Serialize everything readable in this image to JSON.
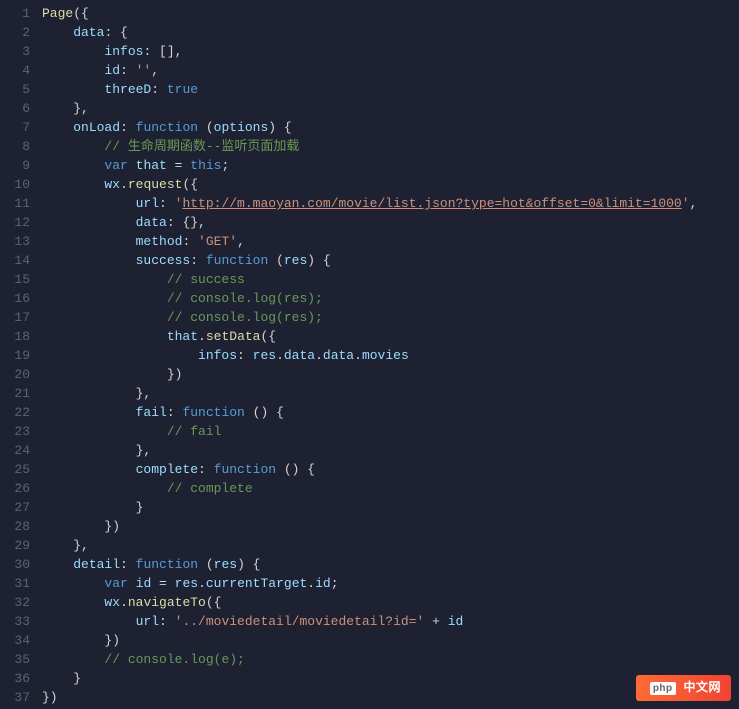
{
  "watermark": {
    "text": "中文网"
  },
  "lines": [
    {
      "n": 1,
      "tokens": [
        {
          "c": "tok-fn",
          "t": "Page"
        },
        {
          "c": "tok-punc",
          "t": "({"
        }
      ]
    },
    {
      "n": 2,
      "tokens": [
        {
          "c": "tok-punc",
          "t": "    "
        },
        {
          "c": "tok-prop",
          "t": "data"
        },
        {
          "c": "tok-punc",
          "t": ": {"
        }
      ]
    },
    {
      "n": 3,
      "tokens": [
        {
          "c": "tok-punc",
          "t": "        "
        },
        {
          "c": "tok-prop",
          "t": "infos"
        },
        {
          "c": "tok-punc",
          "t": ": [],"
        }
      ]
    },
    {
      "n": 4,
      "tokens": [
        {
          "c": "tok-punc",
          "t": "        "
        },
        {
          "c": "tok-prop",
          "t": "id"
        },
        {
          "c": "tok-punc",
          "t": ": "
        },
        {
          "c": "tok-str",
          "t": "''"
        },
        {
          "c": "tok-punc",
          "t": ","
        }
      ]
    },
    {
      "n": 5,
      "tokens": [
        {
          "c": "tok-punc",
          "t": "        "
        },
        {
          "c": "tok-prop",
          "t": "threeD"
        },
        {
          "c": "tok-punc",
          "t": ": "
        },
        {
          "c": "tok-bool",
          "t": "true"
        }
      ]
    },
    {
      "n": 6,
      "tokens": [
        {
          "c": "tok-punc",
          "t": "    },"
        }
      ]
    },
    {
      "n": 7,
      "tokens": [
        {
          "c": "tok-punc",
          "t": "    "
        },
        {
          "c": "tok-prop",
          "t": "onLoad"
        },
        {
          "c": "tok-punc",
          "t": ": "
        },
        {
          "c": "tok-kw",
          "t": "function"
        },
        {
          "c": "tok-punc",
          "t": " ("
        },
        {
          "c": "tok-var",
          "t": "options"
        },
        {
          "c": "tok-punc",
          "t": ") {"
        }
      ]
    },
    {
      "n": 8,
      "tokens": [
        {
          "c": "tok-punc",
          "t": "        "
        },
        {
          "c": "tok-comment",
          "t": "// 生命周期函数--监听页面加载"
        }
      ]
    },
    {
      "n": 9,
      "tokens": [
        {
          "c": "tok-punc",
          "t": "        "
        },
        {
          "c": "tok-kw",
          "t": "var"
        },
        {
          "c": "tok-punc",
          "t": " "
        },
        {
          "c": "tok-var",
          "t": "that"
        },
        {
          "c": "tok-punc",
          "t": " = "
        },
        {
          "c": "tok-this",
          "t": "this"
        },
        {
          "c": "tok-punc",
          "t": ";"
        }
      ]
    },
    {
      "n": 10,
      "tokens": [
        {
          "c": "tok-punc",
          "t": "        "
        },
        {
          "c": "tok-var",
          "t": "wx"
        },
        {
          "c": "tok-punc",
          "t": "."
        },
        {
          "c": "tok-fn",
          "t": "request"
        },
        {
          "c": "tok-punc",
          "t": "({"
        }
      ]
    },
    {
      "n": 11,
      "tokens": [
        {
          "c": "tok-punc",
          "t": "            "
        },
        {
          "c": "tok-prop",
          "t": "url"
        },
        {
          "c": "tok-punc",
          "t": ": "
        },
        {
          "c": "tok-str",
          "t": "'"
        },
        {
          "c": "tok-url",
          "t": "http://m.maoyan.com/movie/list.json?type=hot&offset=0&limit=1000"
        },
        {
          "c": "tok-str",
          "t": "'"
        },
        {
          "c": "tok-punc",
          "t": ","
        }
      ]
    },
    {
      "n": 12,
      "tokens": [
        {
          "c": "tok-punc",
          "t": "            "
        },
        {
          "c": "tok-prop",
          "t": "data"
        },
        {
          "c": "tok-punc",
          "t": ": {},"
        }
      ]
    },
    {
      "n": 13,
      "tokens": [
        {
          "c": "tok-punc",
          "t": "            "
        },
        {
          "c": "tok-prop",
          "t": "method"
        },
        {
          "c": "tok-punc",
          "t": ": "
        },
        {
          "c": "tok-str",
          "t": "'GET'"
        },
        {
          "c": "tok-punc",
          "t": ","
        }
      ]
    },
    {
      "n": 14,
      "tokens": [
        {
          "c": "tok-punc",
          "t": "            "
        },
        {
          "c": "tok-prop",
          "t": "success"
        },
        {
          "c": "tok-punc",
          "t": ": "
        },
        {
          "c": "tok-kw",
          "t": "function"
        },
        {
          "c": "tok-punc",
          "t": " ("
        },
        {
          "c": "tok-var",
          "t": "res"
        },
        {
          "c": "tok-punc",
          "t": ") {"
        }
      ]
    },
    {
      "n": 15,
      "tokens": [
        {
          "c": "tok-punc",
          "t": "                "
        },
        {
          "c": "tok-comment",
          "t": "// success"
        }
      ]
    },
    {
      "n": 16,
      "tokens": [
        {
          "c": "tok-punc",
          "t": "                "
        },
        {
          "c": "tok-comment",
          "t": "// console.log(res);"
        }
      ]
    },
    {
      "n": 17,
      "tokens": [
        {
          "c": "tok-punc",
          "t": "                "
        },
        {
          "c": "tok-comment",
          "t": "// console.log(res);"
        }
      ]
    },
    {
      "n": 18,
      "tokens": [
        {
          "c": "tok-punc",
          "t": "                "
        },
        {
          "c": "tok-var",
          "t": "that"
        },
        {
          "c": "tok-punc",
          "t": "."
        },
        {
          "c": "tok-fn",
          "t": "setData"
        },
        {
          "c": "tok-punc",
          "t": "({"
        }
      ]
    },
    {
      "n": 19,
      "tokens": [
        {
          "c": "tok-punc",
          "t": "                    "
        },
        {
          "c": "tok-prop",
          "t": "infos"
        },
        {
          "c": "tok-punc",
          "t": ": "
        },
        {
          "c": "tok-var",
          "t": "res"
        },
        {
          "c": "tok-punc",
          "t": "."
        },
        {
          "c": "tok-var",
          "t": "data"
        },
        {
          "c": "tok-punc",
          "t": "."
        },
        {
          "c": "tok-var",
          "t": "data"
        },
        {
          "c": "tok-punc",
          "t": "."
        },
        {
          "c": "tok-var",
          "t": "movies"
        }
      ]
    },
    {
      "n": 20,
      "tokens": [
        {
          "c": "tok-punc",
          "t": "                })"
        }
      ]
    },
    {
      "n": 21,
      "tokens": [
        {
          "c": "tok-punc",
          "t": "            },"
        }
      ]
    },
    {
      "n": 22,
      "tokens": [
        {
          "c": "tok-punc",
          "t": "            "
        },
        {
          "c": "tok-prop",
          "t": "fail"
        },
        {
          "c": "tok-punc",
          "t": ": "
        },
        {
          "c": "tok-kw",
          "t": "function"
        },
        {
          "c": "tok-punc",
          "t": " () {"
        }
      ]
    },
    {
      "n": 23,
      "tokens": [
        {
          "c": "tok-punc",
          "t": "                "
        },
        {
          "c": "tok-comment",
          "t": "// fail"
        }
      ]
    },
    {
      "n": 24,
      "tokens": [
        {
          "c": "tok-punc",
          "t": "            },"
        }
      ]
    },
    {
      "n": 25,
      "tokens": [
        {
          "c": "tok-punc",
          "t": "            "
        },
        {
          "c": "tok-prop",
          "t": "complete"
        },
        {
          "c": "tok-punc",
          "t": ": "
        },
        {
          "c": "tok-kw",
          "t": "function"
        },
        {
          "c": "tok-punc",
          "t": " () {"
        }
      ]
    },
    {
      "n": 26,
      "tokens": [
        {
          "c": "tok-punc",
          "t": "                "
        },
        {
          "c": "tok-comment",
          "t": "// complete"
        }
      ]
    },
    {
      "n": 27,
      "tokens": [
        {
          "c": "tok-punc",
          "t": "            }"
        }
      ]
    },
    {
      "n": 28,
      "tokens": [
        {
          "c": "tok-punc",
          "t": "        })"
        }
      ]
    },
    {
      "n": 29,
      "tokens": [
        {
          "c": "tok-punc",
          "t": "    },"
        }
      ]
    },
    {
      "n": 30,
      "tokens": [
        {
          "c": "tok-punc",
          "t": "    "
        },
        {
          "c": "tok-prop",
          "t": "detail"
        },
        {
          "c": "tok-punc",
          "t": ": "
        },
        {
          "c": "tok-kw",
          "t": "function"
        },
        {
          "c": "tok-punc",
          "t": " ("
        },
        {
          "c": "tok-var",
          "t": "res"
        },
        {
          "c": "tok-punc",
          "t": ") {"
        }
      ]
    },
    {
      "n": 31,
      "tokens": [
        {
          "c": "tok-punc",
          "t": "        "
        },
        {
          "c": "tok-kw",
          "t": "var"
        },
        {
          "c": "tok-punc",
          "t": " "
        },
        {
          "c": "tok-var",
          "t": "id"
        },
        {
          "c": "tok-punc",
          "t": " = "
        },
        {
          "c": "tok-var",
          "t": "res"
        },
        {
          "c": "tok-punc",
          "t": "."
        },
        {
          "c": "tok-var",
          "t": "currentTarget"
        },
        {
          "c": "tok-punc",
          "t": "."
        },
        {
          "c": "tok-var",
          "t": "id"
        },
        {
          "c": "tok-punc",
          "t": ";"
        }
      ]
    },
    {
      "n": 32,
      "tokens": [
        {
          "c": "tok-punc",
          "t": "        "
        },
        {
          "c": "tok-var",
          "t": "wx"
        },
        {
          "c": "tok-punc",
          "t": "."
        },
        {
          "c": "tok-fn",
          "t": "navigateTo"
        },
        {
          "c": "tok-punc",
          "t": "({"
        }
      ]
    },
    {
      "n": 33,
      "tokens": [
        {
          "c": "tok-punc",
          "t": "            "
        },
        {
          "c": "tok-prop",
          "t": "url"
        },
        {
          "c": "tok-punc",
          "t": ": "
        },
        {
          "c": "tok-str",
          "t": "'../moviedetail/moviedetail?id='"
        },
        {
          "c": "tok-punc",
          "t": " + "
        },
        {
          "c": "tok-var",
          "t": "id"
        }
      ]
    },
    {
      "n": 34,
      "tokens": [
        {
          "c": "tok-punc",
          "t": "        })"
        }
      ]
    },
    {
      "n": 35,
      "tokens": [
        {
          "c": "tok-punc",
          "t": "        "
        },
        {
          "c": "tok-comment",
          "t": "// console.log(e);"
        }
      ]
    },
    {
      "n": 36,
      "tokens": [
        {
          "c": "tok-punc",
          "t": "    }"
        }
      ]
    },
    {
      "n": 37,
      "tokens": [
        {
          "c": "tok-punc",
          "t": "})"
        }
      ]
    }
  ]
}
